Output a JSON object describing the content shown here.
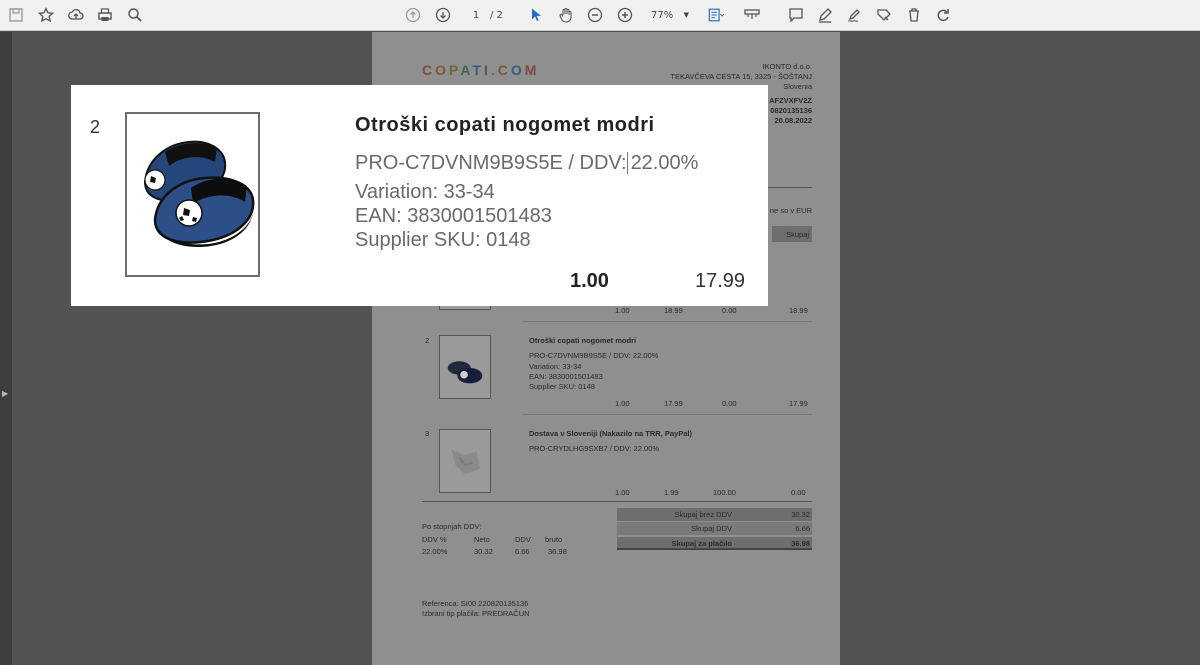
{
  "toolbar": {
    "page_current": "1",
    "page_total": "/ 2",
    "zoom": "77%"
  },
  "doc": {
    "logo": "COPATI.COM",
    "company": "IKONTO d.o.o.",
    "street": "TEKAVČEVA CESTA 15, 3325 - ŠOŠTANJ",
    "country": "Slovenia",
    "meta1": "AFZVXFV2Z",
    "meta2": "0820135136",
    "meta3": "20.08.2022",
    "currency_note": "ne so v EUR",
    "col_total": "Skupaj",
    "row1": {
      "qty": "1.00",
      "price": "18.99",
      "disc": "0.00",
      "total": "18.99"
    },
    "row2": {
      "num": "2",
      "title": "Otroški copati nogomet modri",
      "code": "PRO-C7DVNM9B9S5E / DDV: 22.00%",
      "variation": "Variation: 33-34",
      "ean": "EAN: 3830001501483",
      "sku": "Supplier SKU: 0148",
      "qty": "1.00",
      "price": "17.99",
      "disc": "0.00",
      "total": "17.99"
    },
    "row3": {
      "num": "3",
      "title": "Dostava v Sloveniji (Nakazilo na TRR, PayPal)",
      "code": "PRO-CRYDLHG9SXB7 / DDV: 22.00%",
      "qty": "1.00",
      "price": "1.99",
      "disc": "100.00",
      "total": "0.00"
    },
    "vat_title": "Po stopnjah DDV:",
    "vat_headers": [
      "DDV %",
      "Neto",
      "DDV",
      "bruto"
    ],
    "vat_values": [
      "22.00%",
      "30.32",
      "6.66",
      "36.98"
    ],
    "sum_net_label": "Skupaj brez DDV",
    "sum_net": "30.32",
    "sum_vat_label": "Skupaj DDV",
    "sum_vat": "6.66",
    "sum_total_label": "Skupaj za plačilo",
    "sum_total": "36.98",
    "reference": "Referenca: SI00 220820135136",
    "payment": "Izbrani tip plačila: PREDRAČUN"
  },
  "popup": {
    "index": "2",
    "title": "Otroški copati nogomet modri",
    "code_prefix": "PRO-C7DVNM9B9S5E / DDV:",
    "code_vat": "22.00%",
    "variation": "Variation: 33-34",
    "ean": "EAN: 3830001501483",
    "sku": "Supplier SKU: 0148",
    "qty": "1.00",
    "price": "17.99"
  }
}
